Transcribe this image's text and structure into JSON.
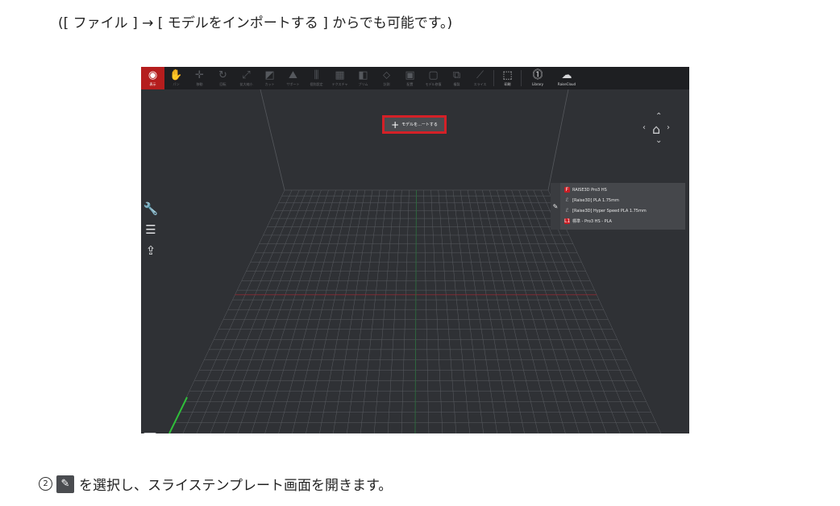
{
  "top_note": "([ ファイル ] → [ モデルをインポートする ] からでも可能です。)",
  "toolbar": {
    "items": [
      {
        "icon": "eye-icon",
        "glyph": "◉",
        "label": "表示",
        "state": "active"
      },
      {
        "icon": "hand-icon",
        "glyph": "✋",
        "label": "パン",
        "state": "disabled"
      },
      {
        "icon": "move-icon",
        "glyph": "✛",
        "label": "移動",
        "state": "disabled"
      },
      {
        "icon": "rotate-icon",
        "glyph": "↻",
        "label": "回転",
        "state": "disabled"
      },
      {
        "icon": "scale-icon",
        "glyph": "⤢",
        "label": "拡大縮小",
        "state": "disabled"
      },
      {
        "icon": "cut-icon",
        "glyph": "◩",
        "label": "カット",
        "state": "disabled"
      },
      {
        "icon": "support-icon",
        "glyph": "⛰",
        "label": "サポート",
        "state": "disabled"
      },
      {
        "icon": "settings-icon",
        "glyph": "⫼",
        "label": "個別設定",
        "state": "disabled"
      },
      {
        "icon": "texture-icon",
        "glyph": "▦",
        "label": "テクスチャ",
        "state": "disabled"
      },
      {
        "icon": "brim-icon",
        "glyph": "◧",
        "label": "ブリム",
        "state": "disabled"
      },
      {
        "icon": "measure-icon",
        "glyph": "⬦",
        "label": "計測",
        "state": "disabled"
      },
      {
        "icon": "arrange-icon",
        "glyph": "▣",
        "label": "配置",
        "state": "disabled"
      },
      {
        "icon": "repair-icon",
        "glyph": "▢",
        "label": "モデル修復",
        "state": "disabled"
      },
      {
        "icon": "copy-icon",
        "glyph": "⧉",
        "label": "複製",
        "state": "disabled"
      },
      {
        "icon": "slice-icon",
        "glyph": "⟋",
        "label": "スライス",
        "state": "disabled"
      },
      {
        "icon": "print-icon",
        "glyph": "⬚",
        "label": "印刷",
        "state": "enabled"
      },
      {
        "icon": "library-icon",
        "glyph": "⓵",
        "label": "Library",
        "state": "enabled"
      },
      {
        "icon": "cloud-icon",
        "glyph": "☁",
        "label": "RaiseCloud",
        "state": "enabled"
      }
    ]
  },
  "import_button": {
    "label": "モデルを...ートする"
  },
  "nav": {
    "up": "⌃",
    "down": "⌄",
    "left": "‹",
    "right": "›",
    "home": "⌂"
  },
  "side_tools": [
    {
      "icon": "wrench-icon",
      "glyph": "🔧"
    },
    {
      "icon": "list-icon",
      "glyph": "☰"
    },
    {
      "icon": "upload-icon",
      "glyph": "⇪"
    }
  ],
  "preset_panel": {
    "edit_glyph": "✎",
    "rows": [
      {
        "icon": "printer-preset-icon",
        "glyph": "F",
        "style": "red",
        "label": "RAISE3D Pro3 HS"
      },
      {
        "icon": "filament-icon",
        "glyph": "ℰ",
        "style": "gray",
        "label": "[Raise3D] PLA 1.75mm"
      },
      {
        "icon": "filament-icon",
        "glyph": "ℰ",
        "style": "gray",
        "label": "[Raise3D] Hyper Speed PLA 1.75mm"
      },
      {
        "icon": "template-icon",
        "glyph": "L1",
        "style": "red",
        "label": "標準 - Pro3 HS - PLA"
      }
    ]
  },
  "keyboard_glyph": "⌨",
  "bottom_note": {
    "step": "2",
    "pen_glyph": "✎",
    "text": "を選択し、スライステンプレート画面を開きます。"
  },
  "colors": {
    "accent_red": "#d42027",
    "viewport_bg": "#2f3135",
    "toolbar_bg": "#1e1f22"
  }
}
